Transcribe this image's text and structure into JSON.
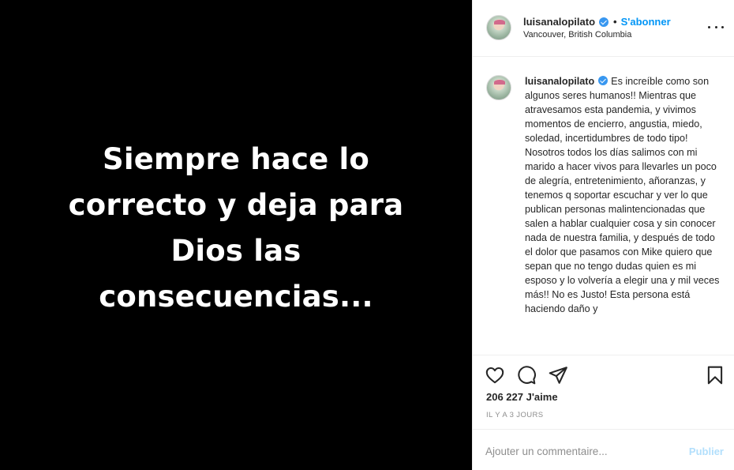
{
  "post": {
    "image_text_lines": [
      "Siempre hace lo",
      "correcto y deja para",
      "Dios las",
      "consecuencias..."
    ]
  },
  "header": {
    "username": "luisanalopilato",
    "separator": "•",
    "follow_label": "S'abonner",
    "location": "Vancouver, British Columbia",
    "more_icon": "more-horizontal-icon"
  },
  "caption": {
    "username": "luisanalopilato",
    "text": "Es increíble como son algunos seres humanos!! Mientras que atravesamos esta pandemia, y vivimos momentos de encierro, angustia, miedo, soledad, incertidumbres de todo tipo! Nosotros todos los días salimos con mi marido a hacer vivos para llevarles un poco de alegría, entretenimiento, añoranzas, y tenemos q soportar escuchar y ver lo que publican personas malintencionadas que salen a hablar cualquier cosa y sin conocer nada de nuestra familia, y después de todo el dolor que pasamos con Mike quiero que sepan que no tengo dudas quien es mi esposo y lo volvería a elegir una y mil veces más!! No es Justo! Esta persona está haciendo daño y"
  },
  "actions": {
    "icons": [
      "heart-icon",
      "comment-icon",
      "share-icon",
      "bookmark-icon"
    ],
    "likes": "206 227 J'aime",
    "timestamp": "IL Y A 3 JOURS"
  },
  "comment": {
    "placeholder": "Ajouter un commentaire...",
    "publish_label": "Publier"
  },
  "colors": {
    "accent": "#0095f6",
    "verified": "#3897f0",
    "publish_disabled": "#b2dffc",
    "media_background": "#000000"
  }
}
